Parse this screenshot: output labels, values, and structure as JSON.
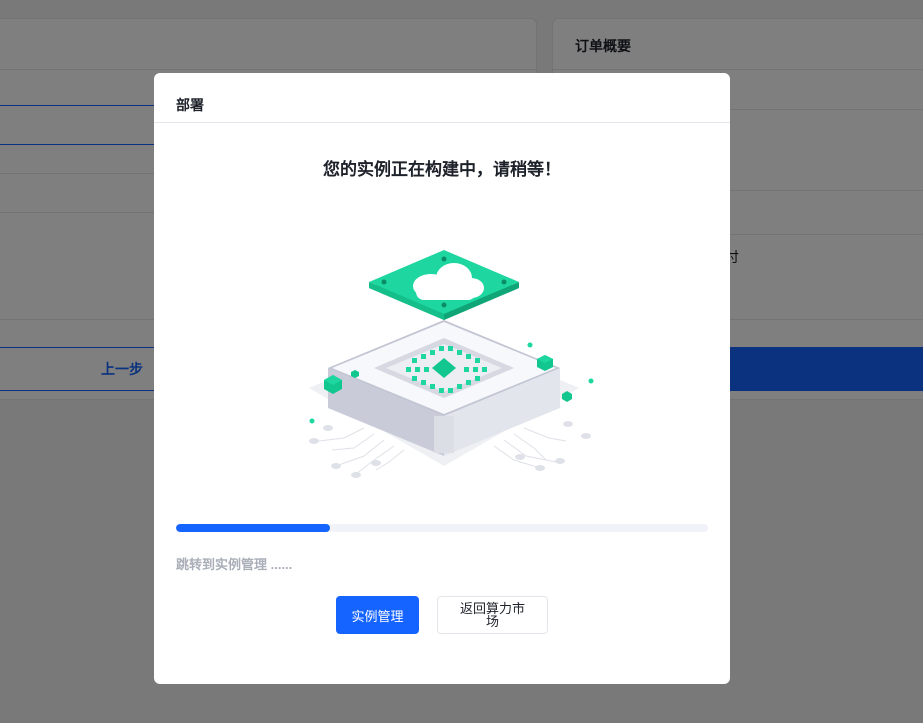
{
  "background": {
    "prev_step_label": "上一步",
    "order_summary_title": "订单概要",
    "right_row_fragment": "付",
    "brand_color": "#1664ff"
  },
  "modal": {
    "title": "部署",
    "heading": "您的实例正在构建中，请稍等！",
    "progress": {
      "value": 0.29
    },
    "redirect_text": "跳转到实例管理 ......",
    "primary_button": "实例管理",
    "secondary_button": "返回算力市场",
    "illustration": "cloud-chip-icon"
  },
  "colors": {
    "primary": "#1664ff",
    "accent_green": "#1ed7a0",
    "muted_text": "#a9aeb8"
  }
}
